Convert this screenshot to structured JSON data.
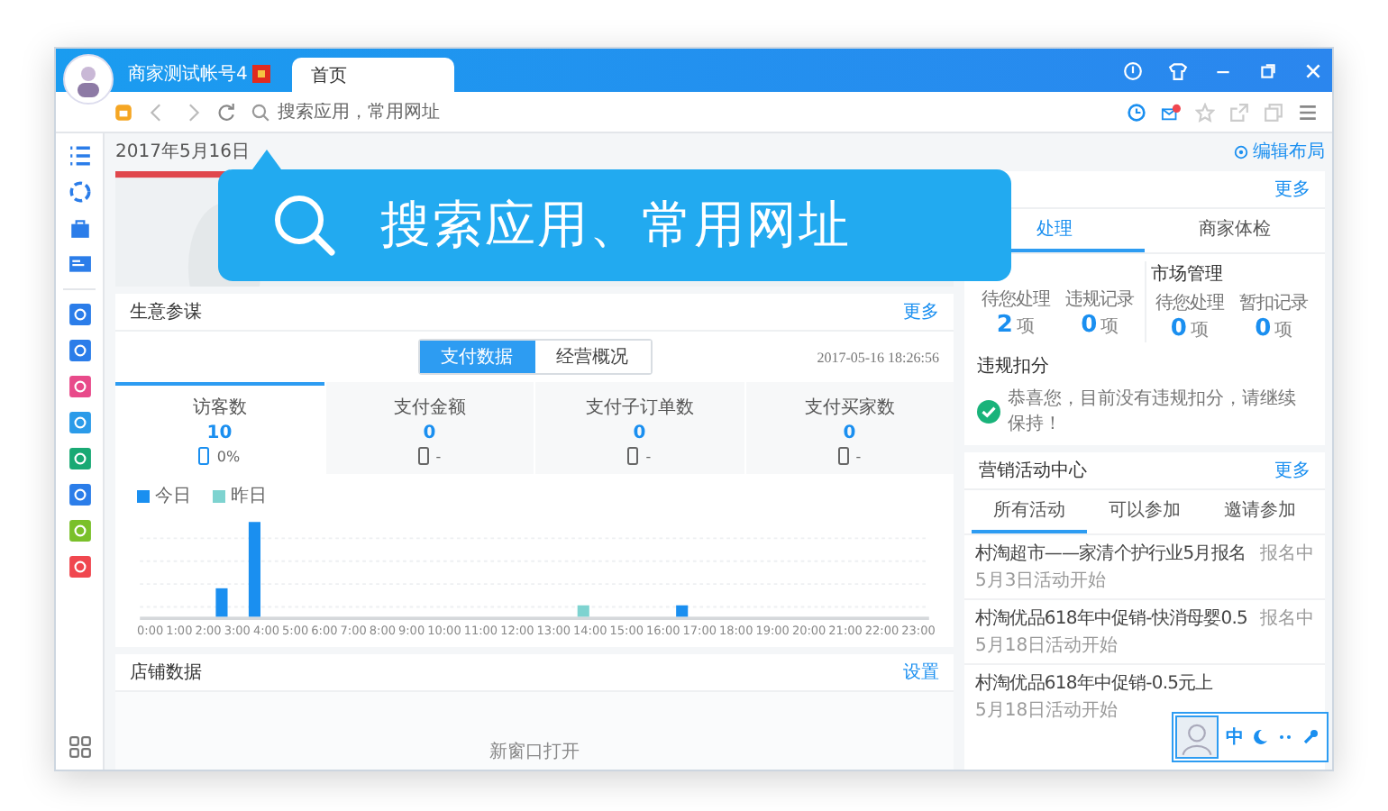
{
  "user": {
    "name": "商家测试帐号4"
  },
  "tabs": [
    {
      "label": "首页",
      "selected": true
    }
  ],
  "address": {
    "placeholder": "搜索应用，常用网址"
  },
  "tooltip": {
    "text": "搜索应用、常用网址"
  },
  "date": "2017年5月16日",
  "business": {
    "title": "生意参谋",
    "more": "更多",
    "toggles": [
      {
        "label": "支付数据",
        "selected": true
      },
      {
        "label": "经营概况",
        "selected": false
      }
    ],
    "timestamp": "2017-05-16 18:26:56",
    "metrics": [
      {
        "label": "访客数",
        "value": "10",
        "change": "0%",
        "selected": true
      },
      {
        "label": "支付金额",
        "value": "0",
        "change": "-",
        "selected": false
      },
      {
        "label": "支付子订单数",
        "value": "0",
        "change": "-",
        "selected": false
      },
      {
        "label": "支付买家数",
        "value": "0",
        "change": "-",
        "selected": false
      }
    ],
    "legend": [
      {
        "label": "今日",
        "color": "#1a8ff0"
      },
      {
        "label": "昨日",
        "color": "#7ed3d0"
      }
    ],
    "hours": [
      "0:00",
      "1:00",
      "2:00",
      "3:00",
      "4:00",
      "5:00",
      "6:00",
      "7:00",
      "8:00",
      "9:00",
      "10:00",
      "11:00",
      "12:00",
      "13:00",
      "14:00",
      "15:00",
      "16:00",
      "17:00",
      "18:00",
      "19:00",
      "20:00",
      "21:00",
      "22:00",
      "23:00"
    ]
  },
  "store": {
    "title": "店铺数据",
    "action": "设置",
    "note": "新窗口打开"
  },
  "edit_layout": "编辑布局",
  "panel": {
    "more": "更多",
    "tabs": [
      {
        "label": "处理",
        "selected": true
      },
      {
        "label": "商家体检",
        "selected": false
      }
    ],
    "groups": [
      {
        "stats": [
          {
            "label": "待您处理",
            "value": "2",
            "unit": "项"
          },
          {
            "label": "违规记录",
            "value": "0",
            "unit": "项"
          }
        ]
      },
      {
        "title": "市场管理",
        "stats": [
          {
            "label": "待您处理",
            "value": "0",
            "unit": "项"
          },
          {
            "label": "暂扣记录",
            "value": "0",
            "unit": "项"
          }
        ]
      }
    ],
    "penalty": {
      "title": "违规扣分",
      "message": "恭喜您，目前没有违规扣分，请继续保持！"
    }
  },
  "marketing": {
    "title": "营销活动中心",
    "more": "更多",
    "tabs": [
      {
        "label": "所有活动",
        "selected": true
      },
      {
        "label": "可以参加",
        "selected": false
      },
      {
        "label": "邀请参加",
        "selected": false
      }
    ],
    "items": [
      {
        "title": "村淘超市——家清个护行业5月报名",
        "date": "5月3日活动开始",
        "status": "报名中"
      },
      {
        "title": "村淘优品618年中促销-快消母婴0.5",
        "date": "5月18日活动开始",
        "status": "报名中"
      },
      {
        "title": "村淘优品618年中促销-0.5元上",
        "date": "5月18日活动开始"
      }
    ]
  },
  "widget": {
    "lang": "中"
  }
}
